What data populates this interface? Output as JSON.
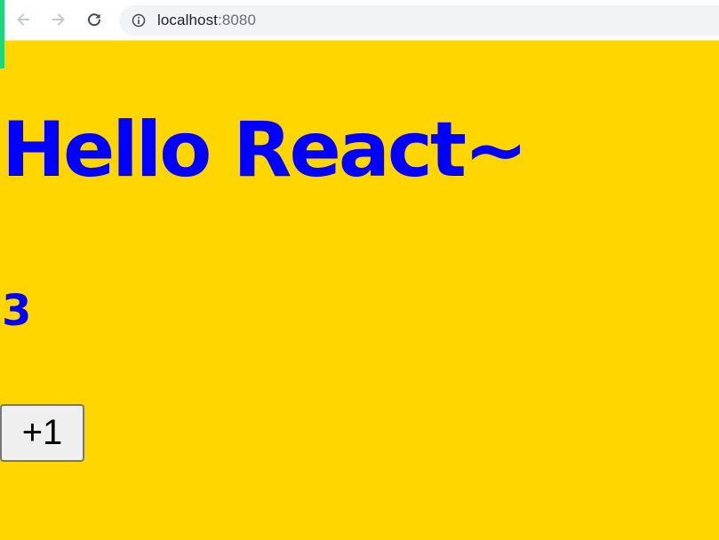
{
  "browser": {
    "url_host": "localhost",
    "url_port": ":8080"
  },
  "app": {
    "title": "Hello React~",
    "count": "3",
    "increment_label": "+1"
  },
  "colors": {
    "page_background": "#ffd600",
    "text": "#0000ff",
    "tab_accent": "#1bd67a"
  },
  "icons": {
    "back": "arrow-left",
    "forward": "arrow-right",
    "reload": "reload",
    "site_info": "info-circle"
  }
}
